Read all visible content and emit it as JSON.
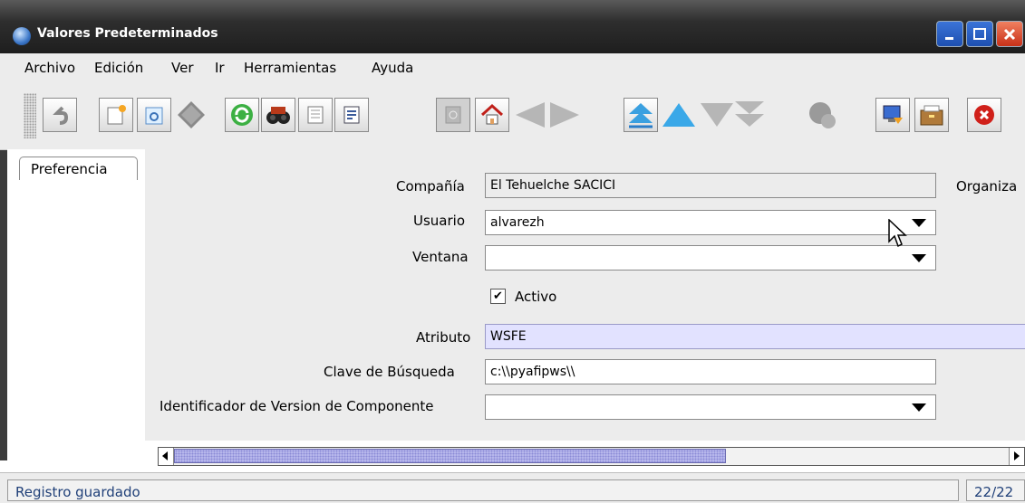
{
  "window": {
    "title": "Valores Predeterminados"
  },
  "menu": [
    {
      "label": "Archivo"
    },
    {
      "label": "Edición"
    },
    {
      "label": "Ver"
    },
    {
      "label": "Ir"
    },
    {
      "label": "Herramientas"
    },
    {
      "label": "Ayuda"
    }
  ],
  "toolbar": {
    "buttons": [
      "undo-icon",
      "new-record-icon",
      "copy-record-icon",
      "delete-icon",
      "refresh-icon",
      "find-icon",
      "attachment-icon",
      "report-icon",
      "history-icon",
      "home-icon",
      "previous-icon",
      "next-icon",
      "first-record-icon",
      "previous-record-icon",
      "next-record-icon",
      "last-record-icon",
      "workflow-icon",
      "export-icon",
      "archive-icon",
      "close-window-icon"
    ]
  },
  "tabs": [
    {
      "label": "Preferencia"
    }
  ],
  "form": {
    "compania": {
      "label": "Compañía",
      "value": "El Tehuelche SACICI"
    },
    "organizacion": {
      "label": "Organiza"
    },
    "usuario": {
      "label": "Usuario",
      "value": "alvarezh"
    },
    "ventana": {
      "label": "Ventana",
      "value": ""
    },
    "activo": {
      "label": "Activo",
      "checked": true,
      "mark": "✔"
    },
    "atributo": {
      "label": "Atributo",
      "value": "WSFE"
    },
    "clave": {
      "label": "Clave de Búsqueda",
      "value": "c:\\\\pyafipws\\\\"
    },
    "identificador": {
      "label": "Identificador de Version de Componente",
      "value": ""
    }
  },
  "status": {
    "message": "Registro guardado",
    "record_count": "22/22"
  },
  "colors": {
    "mandatory_field": "#e2e2ff",
    "status_text": "#1f3f78",
    "title_bar": "#2e2e2e"
  }
}
